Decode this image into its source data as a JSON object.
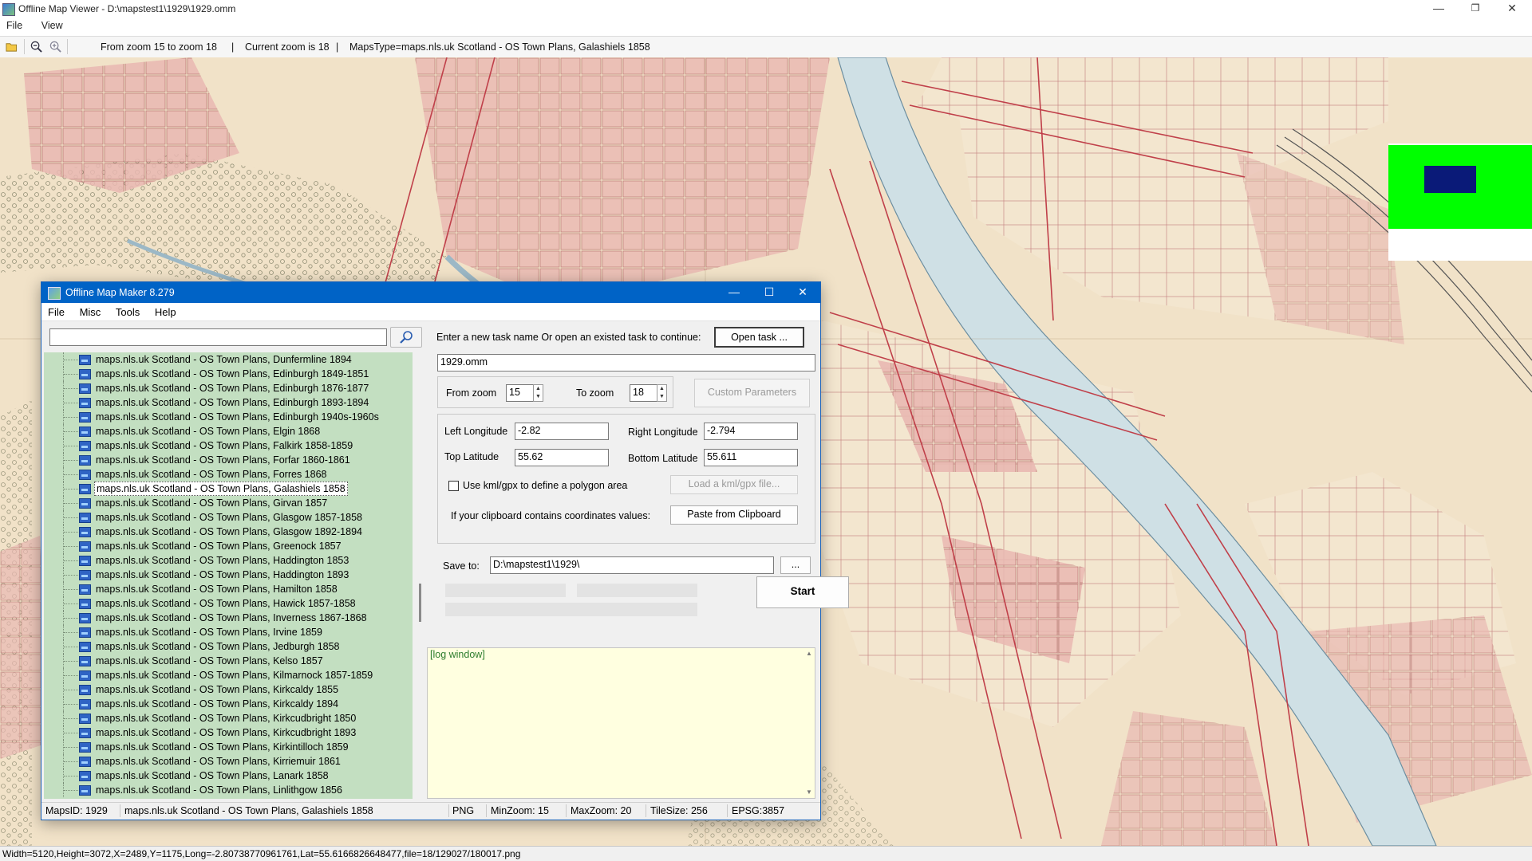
{
  "outer": {
    "title": "Offline Map Viewer - D:\\mapstest1\\1929\\1929.omm",
    "menu": [
      "File",
      "View"
    ],
    "toolbar": {
      "zoom_range": "From zoom 15 to zoom 18",
      "current_zoom": "Current zoom is 18",
      "maps_type": "MapsType=maps.nls.uk Scotland - OS Town Plans, Galashiels 1858",
      "sep": "|"
    },
    "status": "Width=5120,Height=3072,X=2489,Y=1175,Long=-2.80738770961761,Lat=55.6166826648477,file=18/129027/180017.png",
    "window_controls": {
      "minimize": "—",
      "maximize": "❐",
      "close": "✕"
    }
  },
  "colors": {
    "map_base": "#f1e2c8",
    "building_pink": "#e8b4b0",
    "road_red": "#c0404a",
    "river": "#c9dde6",
    "tree_green": "#c3dfc1",
    "title_blue": "#0063c6",
    "overview_green": "#00ff00",
    "overview_blue": "#0a1a78"
  },
  "dialog": {
    "title": "Offline Map Maker 8.279",
    "menu": [
      "File",
      "Misc",
      "Tools",
      "Help"
    ],
    "controls": {
      "minimize": "—",
      "maximize": "☐",
      "close": "✕"
    },
    "search": {
      "value": "",
      "icon": "search-icon"
    },
    "tree_items": [
      "maps.nls.uk Scotland - OS Town Plans, Dunfermline 1894",
      "maps.nls.uk Scotland - OS Town Plans, Edinburgh 1849-1851",
      "maps.nls.uk Scotland - OS Town Plans, Edinburgh 1876-1877",
      "maps.nls.uk Scotland - OS Town Plans, Edinburgh 1893-1894",
      "maps.nls.uk Scotland - OS Town Plans, Edinburgh 1940s-1960s",
      "maps.nls.uk Scotland - OS Town Plans, Elgin 1868",
      "maps.nls.uk Scotland - OS Town Plans, Falkirk 1858-1859",
      "maps.nls.uk Scotland - OS Town Plans, Forfar 1860-1861",
      "maps.nls.uk Scotland - OS Town Plans, Forres 1868",
      "maps.nls.uk Scotland - OS Town Plans, Galashiels 1858",
      "maps.nls.uk Scotland - OS Town Plans, Girvan 1857",
      "maps.nls.uk Scotland - OS Town Plans, Glasgow 1857-1858",
      "maps.nls.uk Scotland - OS Town Plans, Glasgow 1892-1894",
      "maps.nls.uk Scotland - OS Town Plans, Greenock 1857",
      "maps.nls.uk Scotland - OS Town Plans, Haddington 1853",
      "maps.nls.uk Scotland - OS Town Plans, Haddington 1893",
      "maps.nls.uk Scotland - OS Town Plans, Hamilton 1858",
      "maps.nls.uk Scotland - OS Town Plans, Hawick 1857-1858",
      "maps.nls.uk Scotland - OS Town Plans, Inverness 1867-1868",
      "maps.nls.uk Scotland - OS Town Plans, Irvine 1859",
      "maps.nls.uk Scotland - OS Town Plans, Jedburgh 1858",
      "maps.nls.uk Scotland - OS Town Plans, Kelso 1857",
      "maps.nls.uk Scotland - OS Town Plans, Kilmarnock 1857-1859",
      "maps.nls.uk Scotland - OS Town Plans, Kirkcaldy 1855",
      "maps.nls.uk Scotland - OS Town Plans, Kirkcaldy 1894",
      "maps.nls.uk Scotland - OS Town Plans, Kirkcudbright 1850",
      "maps.nls.uk Scotland - OS Town Plans, Kirkcudbright 1893",
      "maps.nls.uk Scotland - OS Town Plans, Kirkintilloch 1859",
      "maps.nls.uk Scotland - OS Town Plans, Kirriemuir 1861",
      "maps.nls.uk Scotland - OS Town Plans, Lanark 1858",
      "maps.nls.uk Scotland - OS Town Plans, Linlithgow 1856"
    ],
    "selected_item": "maps.nls.uk Scotland - OS Town Plans, Galashiels 1858",
    "task_prompt": "Enter a new task name Or open an existed task to continue:",
    "open_task_label": "Open task ...",
    "task_name": "1929.omm",
    "from_zoom_label": "From zoom",
    "from_zoom": "15",
    "to_zoom_label": "To zoom",
    "to_zoom": "18",
    "custom_params_label": "Custom Parameters",
    "left_long_label": "Left Longitude",
    "left_long": "-2.82",
    "right_long_label": "Right Longitude",
    "right_long": "-2.794",
    "top_lat_label": "Top Latitude",
    "top_lat": "55.62",
    "bottom_lat_label": "Bottom Latitude",
    "bottom_lat": "55.611",
    "kml_checkbox_label": "Use kml/gpx to define a polygon area",
    "kml_checked": false,
    "load_kml_label": "Load a kml/gpx file...",
    "clipboard_prompt": "If your clipboard contains coordinates values:",
    "paste_label": "Paste from Clipboard",
    "save_to_label": "Save to:",
    "save_to": "D:\\mapstest1\\1929\\",
    "browse_label": "...",
    "start_label": "Start",
    "log_text": "[log window]",
    "status": {
      "maps_id": "MapsID: 1929",
      "maps_name": "maps.nls.uk Scotland - OS Town Plans, Galashiels 1858",
      "format": "PNG",
      "min_zoom": "MinZoom: 15",
      "max_zoom": "MaxZoom: 20",
      "tile_size": "TileSize: 256",
      "epsg": "EPSG:3857"
    }
  }
}
